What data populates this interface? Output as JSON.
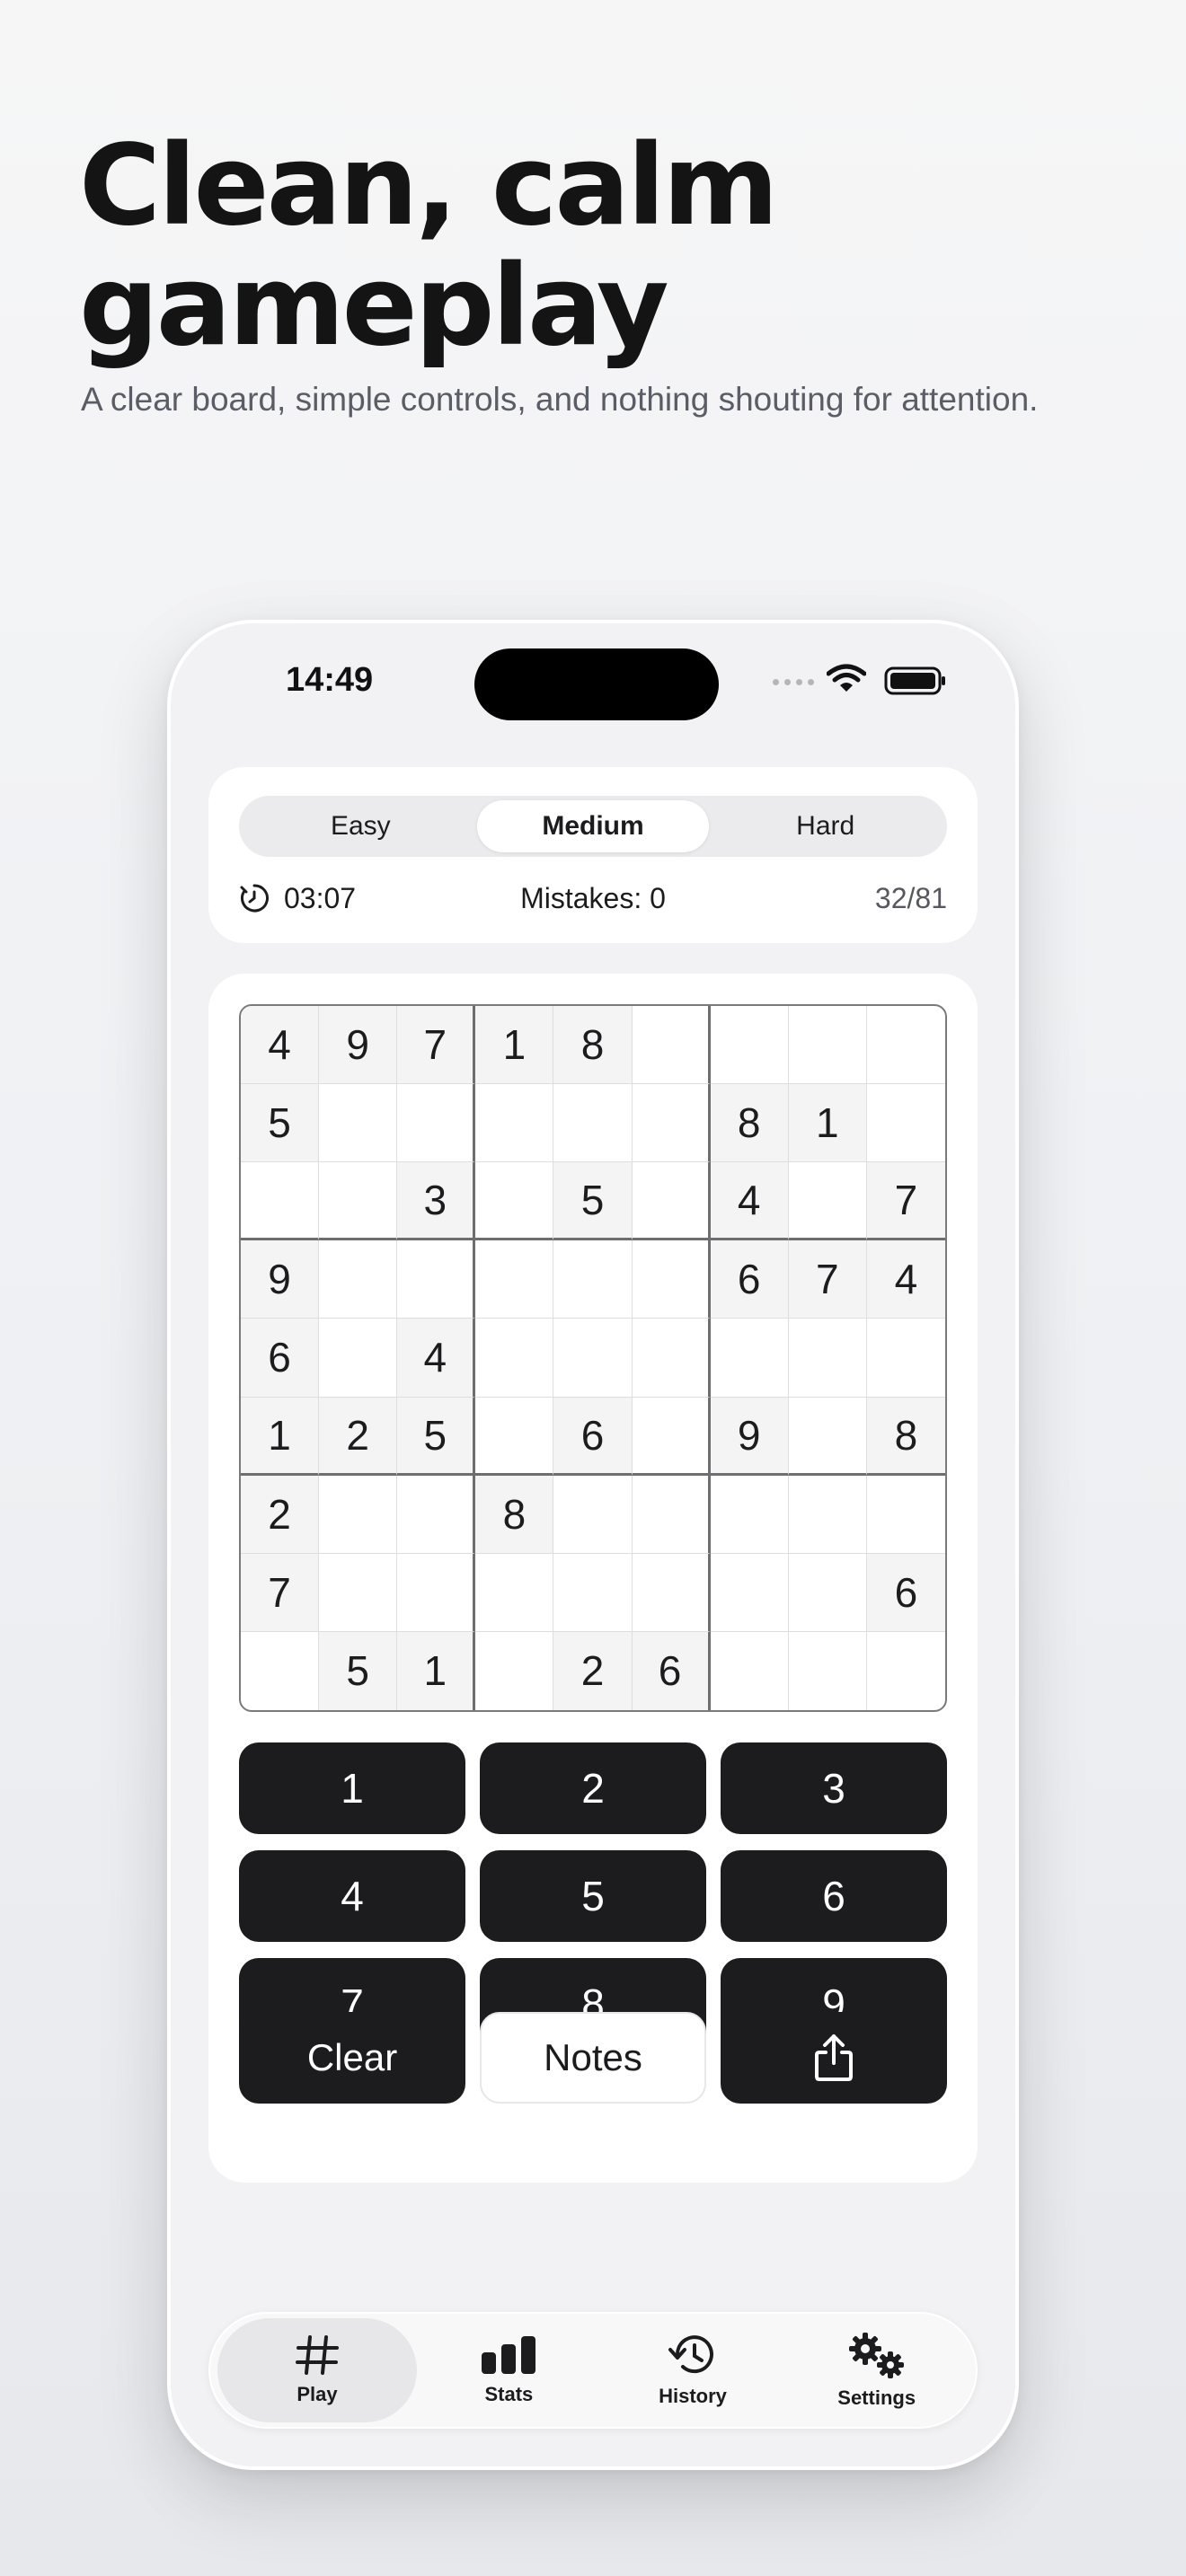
{
  "hero": {
    "title_line1": "Clean, calm",
    "title_line2": "gameplay",
    "subtitle": "A clear board, simple controls, and nothing shouting for attention."
  },
  "status_bar": {
    "time": "14:49"
  },
  "difficulty": {
    "options": [
      "Easy",
      "Medium",
      "Hard"
    ],
    "selected": "Medium"
  },
  "game_status": {
    "timer": "03:07",
    "mistakes": "Mistakes: 0",
    "progress": "32/81"
  },
  "board": [
    [
      "4",
      "9",
      "7",
      "1",
      "8",
      "",
      "",
      "",
      ""
    ],
    [
      "5",
      "",
      "",
      "",
      "",
      "",
      "8",
      "1",
      ""
    ],
    [
      "",
      "",
      "3",
      "",
      "5",
      "",
      "4",
      "",
      "7"
    ],
    [
      "9",
      "",
      "",
      "",
      "",
      "",
      "6",
      "7",
      "4"
    ],
    [
      "6",
      "",
      "4",
      "",
      "",
      "",
      "",
      "",
      ""
    ],
    [
      "1",
      "2",
      "5",
      "",
      "6",
      "",
      "9",
      "",
      "8"
    ],
    [
      "2",
      "",
      "",
      "8",
      "",
      "",
      "",
      "",
      ""
    ],
    [
      "7",
      "",
      "",
      "",
      "",
      "",
      "",
      "",
      "6"
    ],
    [
      "",
      "5",
      "1",
      "",
      "2",
      "6",
      "",
      "",
      ""
    ]
  ],
  "keypad": [
    "1",
    "2",
    "3",
    "4",
    "5",
    "6",
    "7",
    "8",
    "9"
  ],
  "actions": {
    "clear": "Clear",
    "notes": "Notes",
    "share_icon": "share-icon"
  },
  "tabs": [
    {
      "label": "Play",
      "icon": "hash-icon",
      "active": true
    },
    {
      "label": "Stats",
      "icon": "bar-chart-icon",
      "active": false
    },
    {
      "label": "History",
      "icon": "history-icon",
      "active": false
    },
    {
      "label": "Settings",
      "icon": "gears-icon",
      "active": false
    }
  ],
  "colors": {
    "dark": "#1c1c1e",
    "given_cell": "#f4f4f5",
    "background": "#f2f2f4"
  }
}
